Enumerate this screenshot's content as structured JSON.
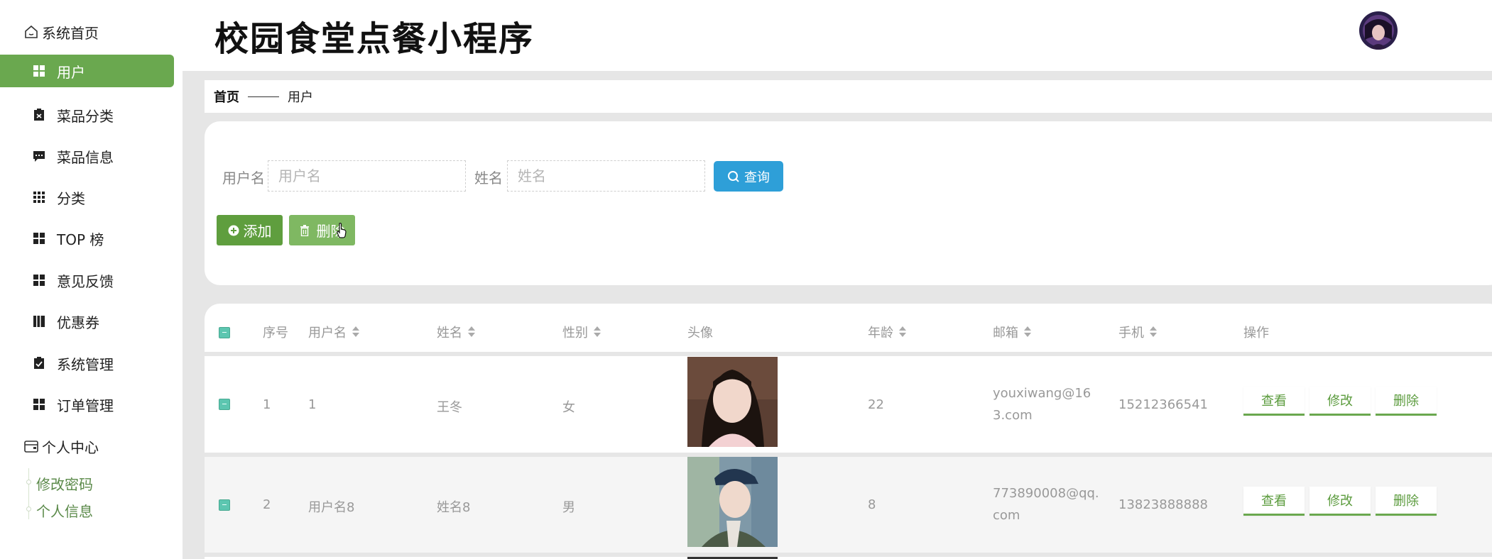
{
  "app": {
    "title": "校园食堂点餐小程序"
  },
  "sidebar": {
    "home": "系统首页",
    "items": [
      {
        "label": "用户",
        "active": true
      },
      {
        "label": "菜品分类"
      },
      {
        "label": "菜品信息"
      },
      {
        "label": "分类"
      },
      {
        "label": "TOP 榜"
      },
      {
        "label": "意见反馈"
      },
      {
        "label": "优惠券"
      },
      {
        "label": "系统管理"
      },
      {
        "label": "订单管理"
      }
    ],
    "personal_center": "个人中心",
    "sub_items": [
      "修改密码",
      "个人信息"
    ]
  },
  "breadcrumb": {
    "home": "首页",
    "current": "用户"
  },
  "search": {
    "username_label": "用户名",
    "username_placeholder": "用户名",
    "name_label": "姓名",
    "name_placeholder": "姓名",
    "query_button": "查询"
  },
  "actions": {
    "add": "添加",
    "delete": "删除"
  },
  "table": {
    "columns": [
      "序号",
      "用户名",
      "姓名",
      "性别",
      "头像",
      "年龄",
      "邮箱",
      "手机",
      "操作"
    ],
    "rows": [
      {
        "index": "1",
        "username": "1",
        "name": "王冬",
        "gender": "女",
        "age": "22",
        "email": "youxiwang@163.com",
        "phone": "15212366541"
      },
      {
        "index": "2",
        "username": "用户名8",
        "name": "姓名8",
        "gender": "男",
        "age": "8",
        "email": "773890008@qq.com",
        "phone": "13823888888"
      }
    ],
    "row_actions": {
      "view": "查看",
      "edit": "修改",
      "delete": "删除"
    }
  },
  "colors": {
    "accent": "#6aa84f",
    "query": "#2e9fd8",
    "checkbox": "#5cc6b0"
  }
}
